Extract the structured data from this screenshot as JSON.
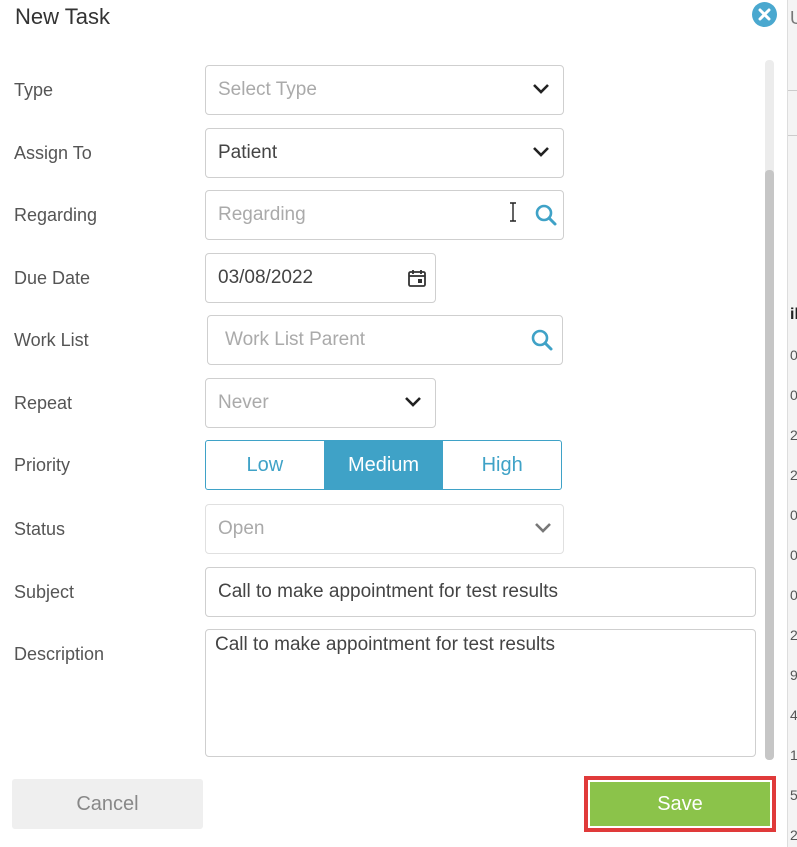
{
  "modal": {
    "title": "New Task"
  },
  "labels": {
    "type": "Type",
    "assign_to": "Assign To",
    "regarding": "Regarding",
    "due_date": "Due Date",
    "work_list": "Work List",
    "repeat": "Repeat",
    "priority": "Priority",
    "status": "Status",
    "subject": "Subject",
    "description": "Description"
  },
  "fields": {
    "type": {
      "placeholder": "Select Type"
    },
    "assign_to": {
      "value": "Patient"
    },
    "regarding": {
      "placeholder": "Regarding"
    },
    "due_date": {
      "value": "03/08/2022"
    },
    "work_list": {
      "placeholder": "Work List Parent"
    },
    "repeat": {
      "value": "Never"
    },
    "status": {
      "value": "Open"
    },
    "subject": {
      "value": "Call to make appointment for test results"
    },
    "description": {
      "value": "Call to make appointment for test results"
    }
  },
  "priority": {
    "options": [
      "Low",
      "Medium",
      "High"
    ],
    "selected": "Medium"
  },
  "buttons": {
    "cancel": "Cancel",
    "save": "Save"
  },
  "background": {
    "header": "U",
    "column": "il",
    "cells": [
      "0",
      "0",
      "2",
      "2",
      "0",
      "0",
      "0",
      "2",
      "9",
      "4",
      "1",
      "5",
      "2"
    ]
  },
  "colors": {
    "accent": "#3fa2c7",
    "save": "#8bc34a",
    "highlight": "#e03a3a"
  }
}
